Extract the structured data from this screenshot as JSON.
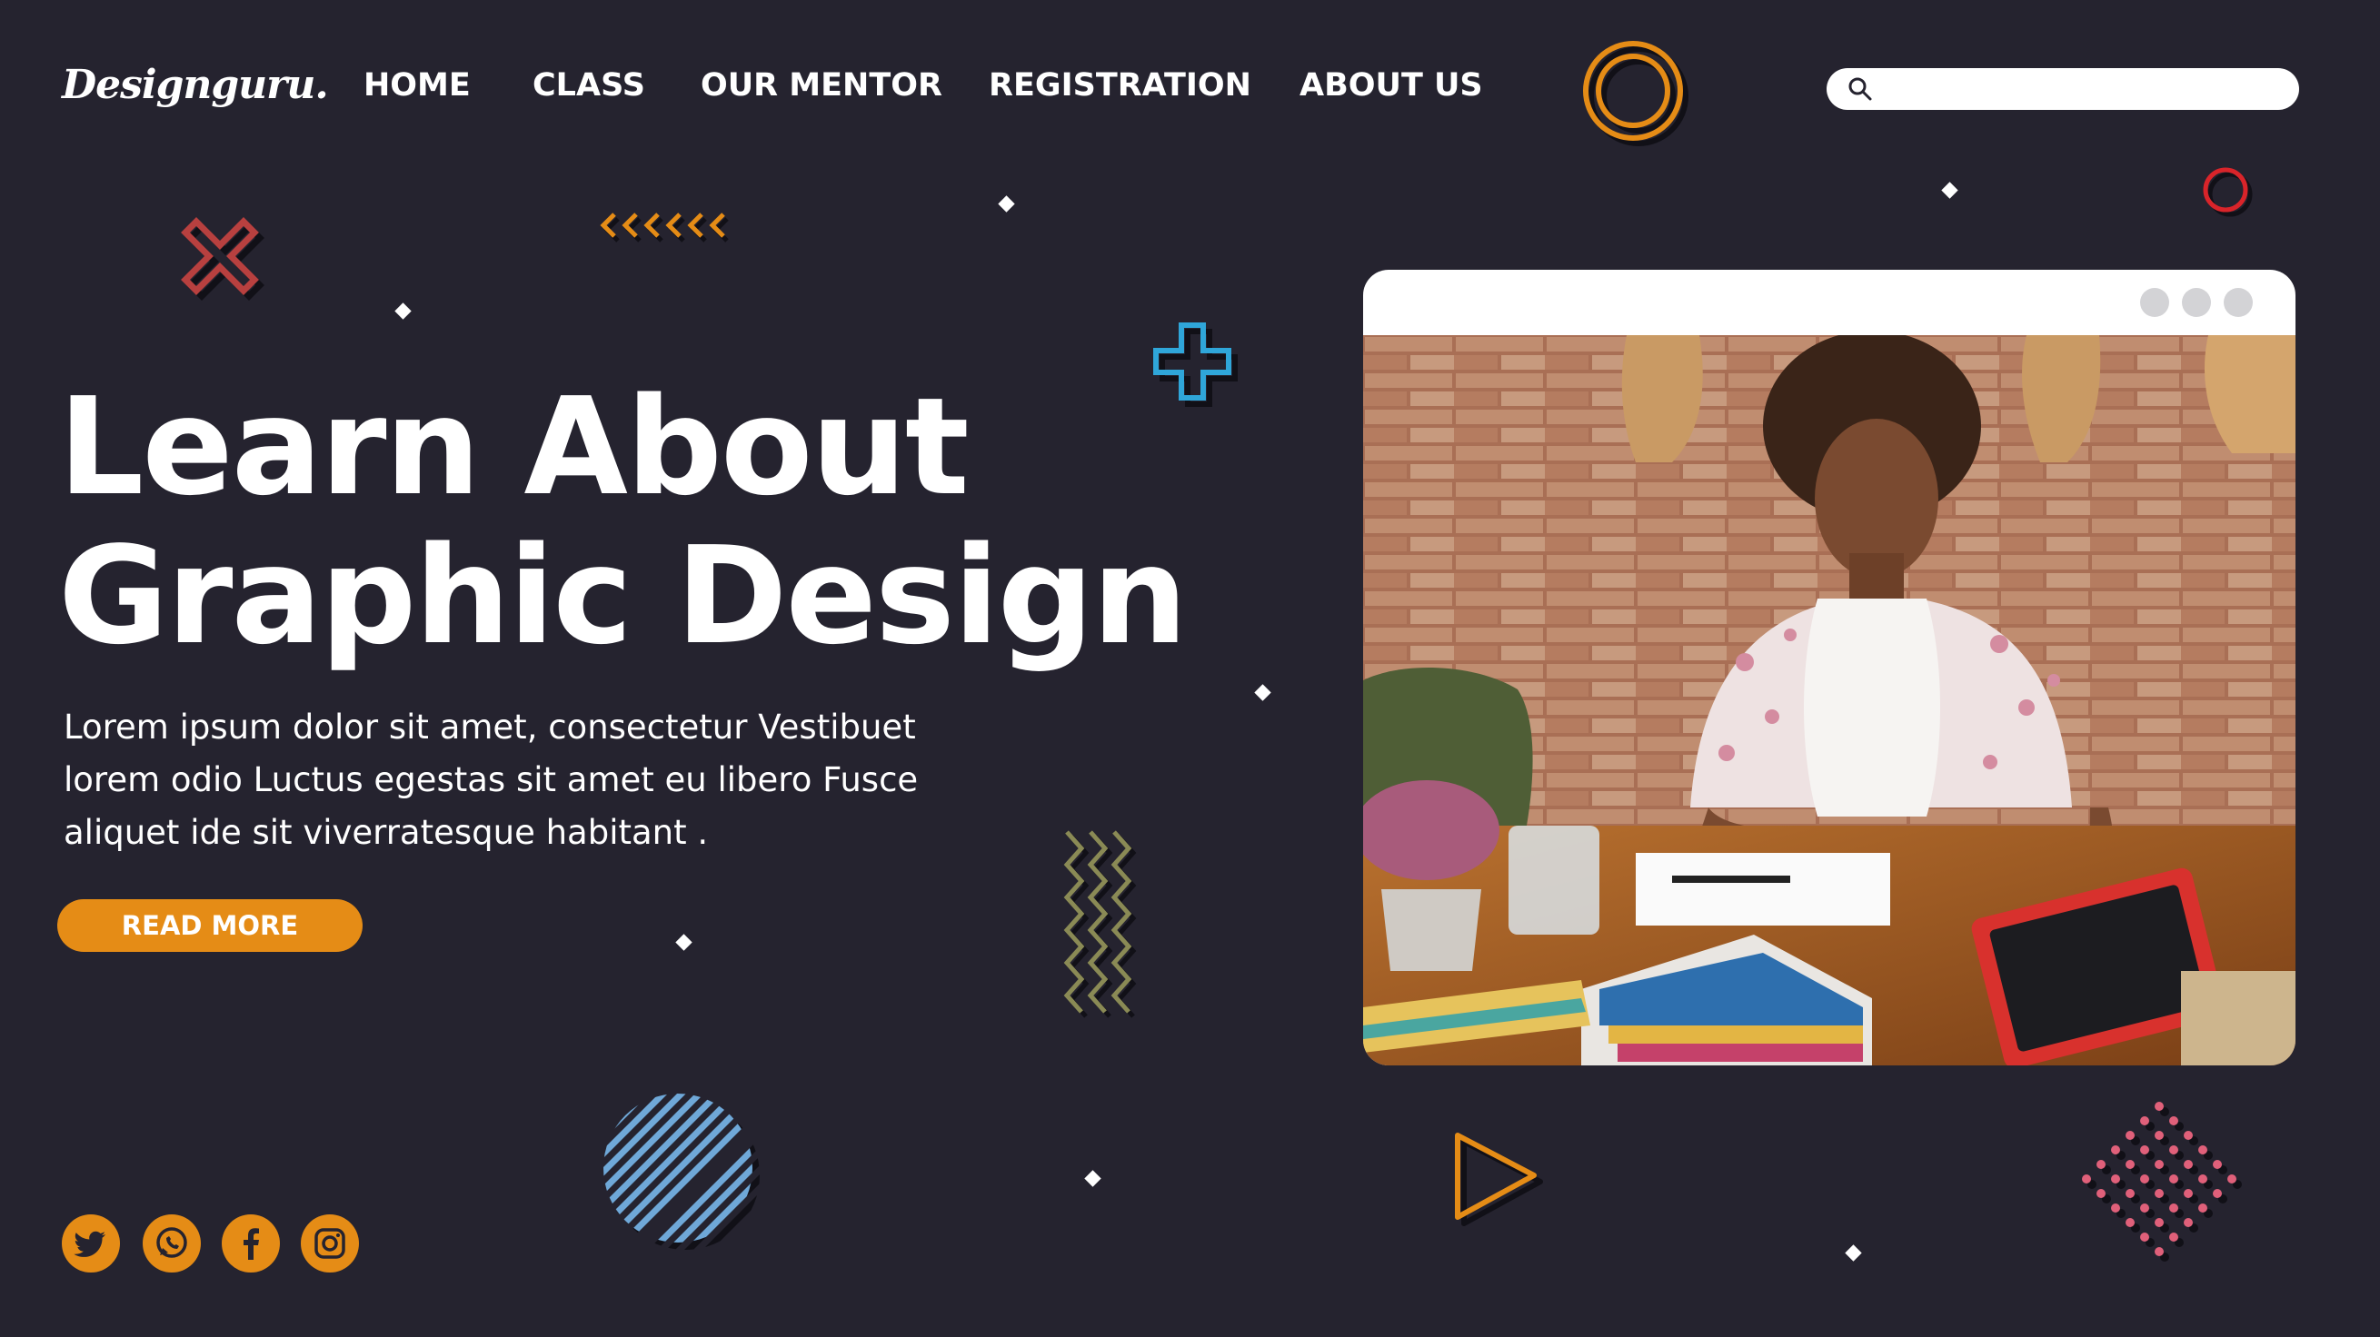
{
  "brand": {
    "logo": "Designguru."
  },
  "nav": {
    "items": [
      {
        "label": "HOME"
      },
      {
        "label": "CLASS"
      },
      {
        "label": "OUR MENTOR"
      },
      {
        "label": "REGISTRATION"
      },
      {
        "label": "ABOUT US"
      }
    ]
  },
  "search": {
    "placeholder": "",
    "value": "",
    "icon": "search-icon"
  },
  "hero": {
    "title_line1": "Learn About",
    "title_line2": "Graphic Design",
    "body": "Lorem ipsum dolor sit amet, consectetur Vestibuet lorem odio Luctus egestas sit amet eu libero Fusce aliquet ide sit viverratesque habitant .",
    "cta_label": "READ MORE"
  },
  "social": [
    "twitter-icon",
    "whatsapp-icon",
    "facebook-icon",
    "instagram-icon"
  ],
  "browser_window": {
    "controls": [
      "dot",
      "dot",
      "dot"
    ]
  },
  "colors": {
    "background": "#25232f",
    "accent": "#e58c16",
    "text": "#ffffff",
    "red": "#d9242a",
    "blue": "#2fa6d9",
    "olive": "#8a8a55",
    "pink": "#e0607a",
    "stripe_blue": "#6fa8d8"
  }
}
